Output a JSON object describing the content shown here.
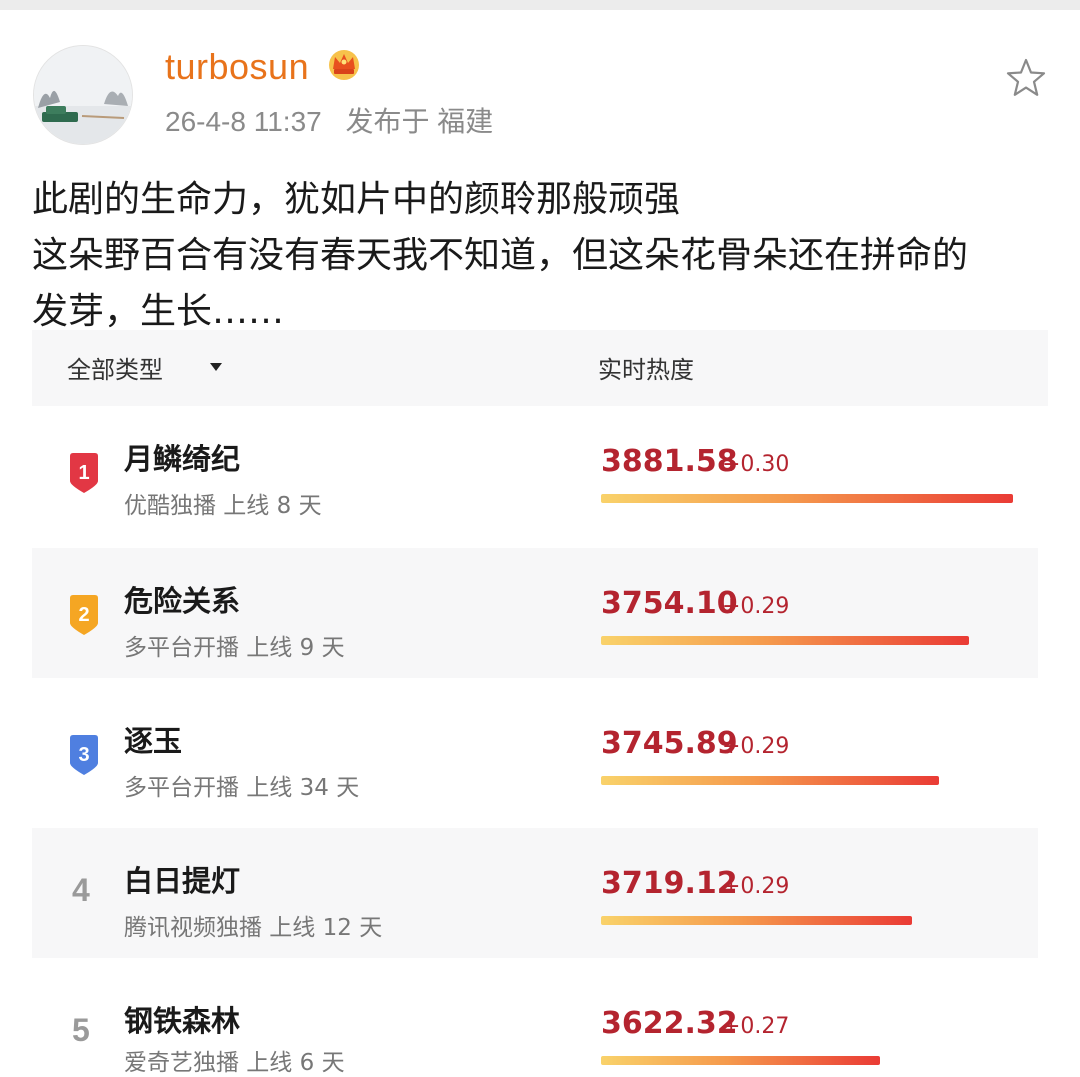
{
  "post": {
    "username": "turbosun",
    "time": "26-4-8 11:37",
    "location": "发布于 福建",
    "text_lines": [
      "此剧的生命力，犹如片中的颜聆那般顽强",
      "这朵野百合有没有春天我不知道，但这朵花骨朵还在拼命的",
      "发芽，生长……"
    ],
    "icons": {
      "avatar": "avatar-photo",
      "vip": "crown-icon",
      "favorite": "star-icon"
    }
  },
  "ranking": {
    "filter_label": "全部类型",
    "heat_label": "实时热度",
    "colors": {
      "score": "#b4242f",
      "bar_start": "#f9d26a",
      "bar_end": "#ea3b35",
      "rank1": "#e23744",
      "rank2": "#f5a623",
      "rank3": "#4f7fe0"
    },
    "items": [
      {
        "rank": "1",
        "title": "月鳞绮纪",
        "subtitle": "优酷独播 上线 8 天",
        "score": "3881.58",
        "delta": "+0.30",
        "heat_fraction": 1.0
      },
      {
        "rank": "2",
        "title": "危险关系",
        "subtitle": "多平台开播 上线 9 天",
        "score": "3754.10",
        "delta": "+0.29",
        "heat_fraction": 0.893
      },
      {
        "rank": "3",
        "title": "逐玉",
        "subtitle": "多平台开播 上线 34 天",
        "score": "3745.89",
        "delta": "+0.29",
        "heat_fraction": 0.82
      },
      {
        "rank": "4",
        "title": "白日提灯",
        "subtitle": "腾讯视频独播 上线 12 天",
        "score": "3719.12",
        "delta": "+0.29",
        "heat_fraction": 0.754
      },
      {
        "rank": "5",
        "title": "钢铁森林",
        "subtitle": "爱奇艺独播 上线 6 天",
        "score": "3622.32",
        "delta": "+0.27",
        "heat_fraction": 0.677
      }
    ]
  }
}
